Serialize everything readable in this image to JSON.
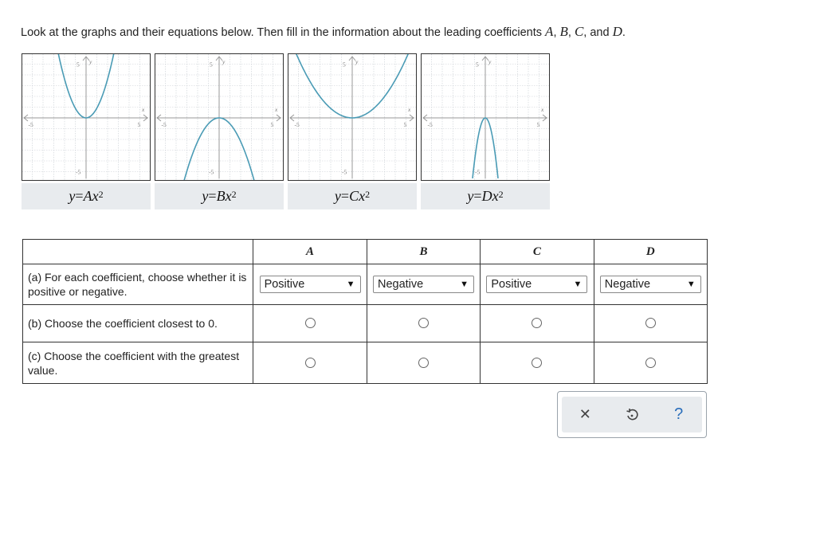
{
  "instructions": {
    "prefix": "Look at the graphs and their equations below. Then fill in the information about the leading coefficients ",
    "v1": "A",
    "sep1": ", ",
    "v2": "B",
    "sep2": ", ",
    "v3": "C",
    "sep3": ", and ",
    "v4": "D",
    "suffix": "."
  },
  "graph_labels": {
    "axis_y": "y",
    "axis_x": "x",
    "tick_pos": "5",
    "tick_neg": "-5"
  },
  "equations": [
    {
      "lhs": "y",
      "eq": "=",
      "coef": "A",
      "x": "x",
      "exp": "2"
    },
    {
      "lhs": "y",
      "eq": "=",
      "coef": "B",
      "x": "x",
      "exp": "2"
    },
    {
      "lhs": "y",
      "eq": "=",
      "coef": "C",
      "x": "x",
      "exp": "2"
    },
    {
      "lhs": "y",
      "eq": "=",
      "coef": "D",
      "x": "x",
      "exp": "2"
    }
  ],
  "table": {
    "headers": [
      "A",
      "B",
      "C",
      "D"
    ],
    "rows": [
      {
        "question": "(a) For each coefficient, choose whether it is positive or negative.",
        "selects": [
          "Positive",
          "Negative",
          "Positive",
          "Negative"
        ]
      },
      {
        "question": "(b) Choose the coefficient closest to 0."
      },
      {
        "question": "(c) Choose the coefficient with the greatest value."
      }
    ]
  },
  "tools": {
    "clear": "✕",
    "undo": "↺",
    "help": "?"
  },
  "colors": {
    "curve": "#4a9bb5",
    "grid": "#c9ced3",
    "label_bg": "#e8ebee"
  }
}
